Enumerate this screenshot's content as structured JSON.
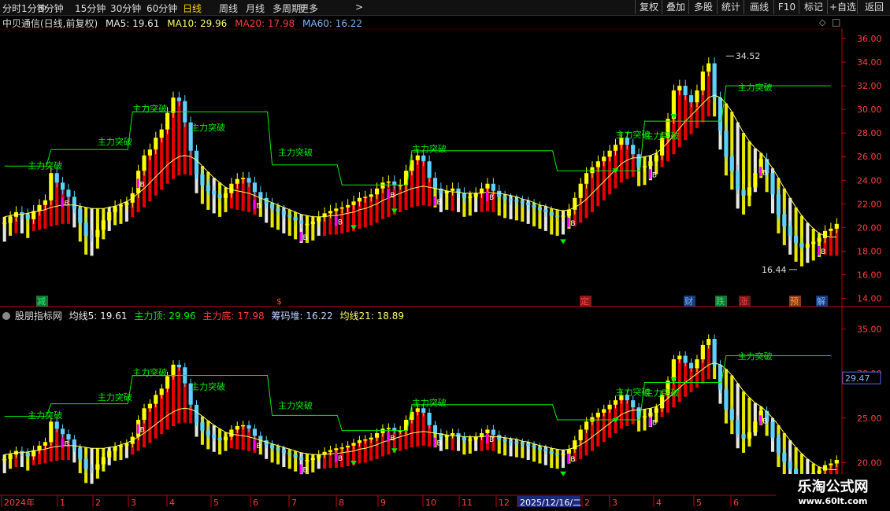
{
  "toolbar": {
    "periods": [
      "分时",
      "1分钟",
      "5分钟",
      "15分钟",
      "30分钟",
      "60分钟",
      "日线",
      "周线",
      "月线",
      "多周期",
      "更多"
    ],
    "active": "日线",
    "more_arrow": ">",
    "right_buttons": [
      "复权",
      "叠加",
      "多股",
      "统计",
      "画线",
      "F10",
      "标记",
      "+自选",
      "返回"
    ]
  },
  "main_header": {
    "title": "中贝通信(日线,前复权)",
    "ma5": "MA5: 19.61",
    "ma10": "MA10: 29.96",
    "ma20": "MA20: 17.98",
    "ma60": "MA60: 16.22",
    "icons": [
      "◇",
      "□"
    ]
  },
  "indicator_header": {
    "name": "股朋指标网",
    "v1": "均线5: 19.61",
    "v2": "主力顶: 29.96",
    "v3": "主力底: 17.98",
    "v4": "筹码堆: 16.22",
    "v5": "均线21: 18.89"
  },
  "colors": {
    "background": "#000000",
    "up": "#ffff00",
    "down": "#5fd0ff",
    "ma_yellow": "#ffff66",
    "ma_green": "#00ee00",
    "red_fill": "#ff0000",
    "white_bar": "#ffffff",
    "magenta": "#ff00ff",
    "axis_red": "#c00000"
  },
  "chart_data": [
    {
      "type": "candlestick",
      "title": "中贝通信(日线,前复权)",
      "yticks": [
        14.0,
        16.0,
        18.0,
        20.0,
        22.0,
        24.0,
        26.0,
        28.0,
        30.0,
        32.0,
        34.0,
        36.0
      ],
      "ylim": [
        13.3,
        36.8
      ],
      "high_label": "34.52",
      "low_label": "16.44",
      "signal_label": "主力突破",
      "b_label": "B",
      "event_labels": [
        "减",
        "$",
        "定",
        "财",
        "跌",
        "涨",
        "预",
        "解"
      ],
      "close_series": [
        20.4,
        20.9,
        21.3,
        21.1,
        20.7,
        21.4,
        21.9,
        22.3,
        24.6,
        23.8,
        23.2,
        22.6,
        21.6,
        20.4,
        19.3,
        19.2,
        19.8,
        20.6,
        21.3,
        21.8,
        21.9,
        22.1,
        22.9,
        24.8,
        26.1,
        26.6,
        27.6,
        28.3,
        29.7,
        31.0,
        30.7,
        28.9,
        26.5,
        24.5,
        23.6,
        23.1,
        22.8,
        22.5,
        22.9,
        23.7,
        24.1,
        24.2,
        23.8,
        23.0,
        22.5,
        22.0,
        21.6,
        21.4,
        21.1,
        20.9,
        20.6,
        20.3,
        20.3,
        20.5,
        20.9,
        21.2,
        21.4,
        21.6,
        21.7,
        21.9,
        22.2,
        22.5,
        22.6,
        22.8,
        23.3,
        23.8,
        23.9,
        23.6,
        23.6,
        24.8,
        25.7,
        26.1,
        25.6,
        24.2,
        23.3,
        22.9,
        23.1,
        23.3,
        22.9,
        22.5,
        22.6,
        22.9,
        23.3,
        23.7,
        23.1,
        22.6,
        22.4,
        22.3,
        22.2,
        22.1,
        21.9,
        21.7,
        21.5,
        21.3,
        21.0,
        20.9,
        21.0,
        21.5,
        22.5,
        23.7,
        24.6,
        25.1,
        25.6,
        26.0,
        26.5,
        27.0,
        27.6,
        27.0,
        26.2,
        25.1,
        25.2,
        25.6,
        26.1,
        27.6,
        29.2,
        31.6,
        32.0,
        31.2,
        30.6,
        31.6,
        33.2,
        33.9,
        31.0,
        28.2,
        26.0,
        24.8,
        23.2,
        22.7,
        23.4,
        24.6,
        25.8,
        24.6,
        22.8,
        21.1,
        20.1,
        19.3,
        18.7,
        18.3,
        18.6,
        18.8,
        19.1,
        19.7,
        19.9,
        20.3
      ],
      "ma_slow": [
        20.9,
        21.0,
        21.1,
        21.1,
        21.2,
        21.3,
        21.4,
        21.5,
        21.7,
        21.8,
        21.9,
        21.9,
        21.9,
        21.8,
        21.7,
        21.6,
        21.6,
        21.6,
        21.7,
        21.8,
        22.0,
        22.2,
        22.5,
        22.9,
        23.3,
        23.8,
        24.3,
        24.8,
        25.3,
        25.7,
        26.0,
        26.1,
        26.0,
        25.7,
        25.2,
        24.7,
        24.2,
        23.8,
        23.4,
        23.2,
        23.1,
        23.0,
        22.9,
        22.7,
        22.5,
        22.3,
        22.1,
        21.9,
        21.7,
        21.5,
        21.3,
        21.1,
        21.0,
        20.9,
        20.9,
        20.9,
        21.0,
        21.0,
        21.1,
        21.2,
        21.3,
        21.5,
        21.6,
        21.8,
        22.0,
        22.3,
        22.5,
        22.7,
        22.9,
        23.1,
        23.3,
        23.4,
        23.5,
        23.4,
        23.3,
        23.2,
        23.1,
        23.0,
        23.0,
        22.9,
        22.9,
        22.9,
        22.9,
        23.0,
        22.9,
        22.9,
        22.8,
        22.7,
        22.6,
        22.4,
        22.3,
        22.1,
        21.9,
        21.8,
        21.6,
        21.5,
        21.4,
        21.5,
        21.7,
        22.0,
        22.4,
        22.9,
        23.4,
        23.9,
        24.4,
        24.9,
        25.4,
        25.7,
        25.9,
        25.9,
        26.0,
        26.1,
        26.3,
        26.7,
        27.2,
        27.8,
        28.4,
        29.0,
        29.5,
        30.0,
        30.5,
        31.0,
        31.2,
        31.0,
        30.5,
        29.8,
        28.9,
        28.0,
        27.3,
        26.7,
        26.3,
        25.7,
        25.0,
        24.2,
        23.3,
        22.5,
        21.7,
        21.0,
        20.4,
        19.9,
        19.5,
        19.3,
        19.2,
        19.2
      ]
    },
    {
      "type": "candlestick",
      "title": "股朋指标网",
      "yticks": [
        20.0,
        25.0,
        30.0,
        35.0
      ],
      "ylim": [
        16.5,
        36.2
      ],
      "current_label": "29.47",
      "signal_label": "主力突破",
      "b_label": "B"
    }
  ],
  "time_axis": {
    "labels": [
      "2024年",
      "1",
      "2",
      "3",
      "4",
      "5",
      "6",
      "7",
      "8",
      "9",
      "10",
      "11",
      "12",
      "2025/12/16/二",
      "2",
      "3",
      "4",
      "5",
      "6"
    ]
  },
  "watermark": {
    "line1": "乐淘公式网",
    "line2": "www.60lt.com"
  }
}
